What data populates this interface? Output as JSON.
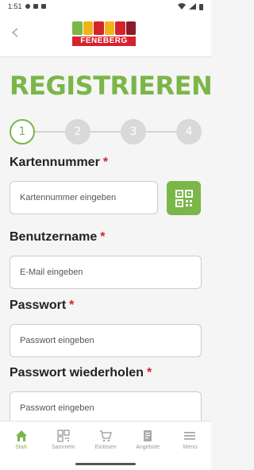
{
  "status_bar": {
    "time": "1:51"
  },
  "header": {
    "logo_text": "FENEBERG",
    "logo_colors": [
      "#7ab648",
      "#f2b31a",
      "#d5232e",
      "#f2b31a",
      "#d5232e",
      "#8b1b2a"
    ]
  },
  "title": "REGISTRIEREN",
  "steps": [
    {
      "label": "1",
      "active": true
    },
    {
      "label": "2",
      "active": false
    },
    {
      "label": "3",
      "active": false
    },
    {
      "label": "4",
      "active": false
    }
  ],
  "form": {
    "card_number": {
      "label": "Kartennummer",
      "required": "*",
      "placeholder": "Kartennummer eingeben"
    },
    "username": {
      "label": "Benutzername",
      "required": "*",
      "placeholder": "E-Mail eingeben"
    },
    "password": {
      "label": "Passwort",
      "required": "*",
      "placeholder": "Passwort eingeben"
    },
    "password_repeat": {
      "label": "Passwort wiederholen",
      "required": "*",
      "placeholder": "Passwort eingeben"
    }
  },
  "tabbar": [
    {
      "label": "Start",
      "icon": "home-icon",
      "active": true
    },
    {
      "label": "Sammeln",
      "icon": "qr-icon",
      "active": false
    },
    {
      "label": "Einlösen",
      "icon": "cart-icon",
      "active": false
    },
    {
      "label": "Angebote",
      "icon": "brochure-icon",
      "active": false
    },
    {
      "label": "Menü",
      "icon": "menu-icon",
      "active": false
    }
  ],
  "colors": {
    "accent": "#7ab648",
    "required": "#d5232e"
  }
}
